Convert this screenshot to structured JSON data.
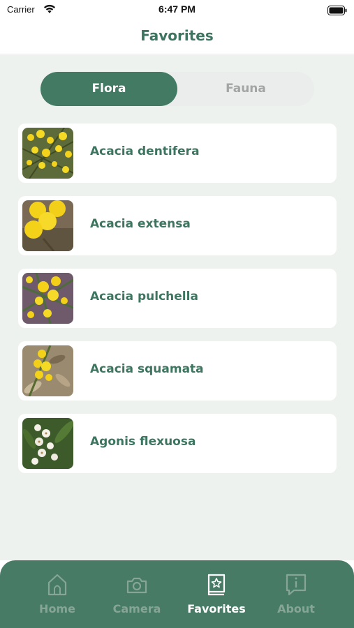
{
  "status_bar": {
    "carrier": "Carrier",
    "time": "6:47 PM"
  },
  "nav": {
    "title": "Favorites"
  },
  "segments": {
    "active": "Flora",
    "inactive": "Fauna"
  },
  "favorites": [
    {
      "name": "Acacia dentifera",
      "thumb": "acacia-dentifera-photo"
    },
    {
      "name": "Acacia extensa",
      "thumb": "acacia-extensa-photo"
    },
    {
      "name": "Acacia pulchella",
      "thumb": "acacia-pulchella-photo"
    },
    {
      "name": "Acacia squamata",
      "thumb": "acacia-squamata-photo"
    },
    {
      "name": "Agonis flexuosa",
      "thumb": "agonis-flexuosa-photo"
    }
  ],
  "tabs": [
    {
      "label": "Home",
      "icon": "home-icon"
    },
    {
      "label": "Camera",
      "icon": "camera-icon"
    },
    {
      "label": "Favorites",
      "icon": "favorites-book-icon"
    },
    {
      "label": "About",
      "icon": "info-icon"
    }
  ],
  "colors": {
    "accent": "#427a63",
    "tab_bar": "#477b66",
    "background": "#eef2ee",
    "text_green": "#3d7560"
  }
}
